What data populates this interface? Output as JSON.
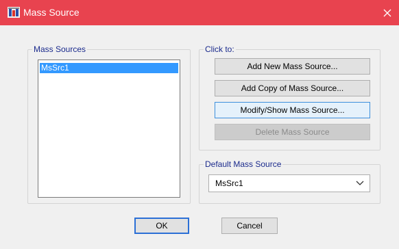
{
  "window": {
    "title": "Mass Source",
    "close_glyph": "✕"
  },
  "mass_sources_group": {
    "label": "Mass Sources",
    "items": [
      "MsSrc1"
    ]
  },
  "click_to_group": {
    "label": "Click to:",
    "buttons": {
      "add_new": "Add New Mass Source...",
      "add_copy": "Add Copy of Mass Source...",
      "modify_show": "Modify/Show Mass Source...",
      "delete": "Delete Mass Source"
    }
  },
  "default_group": {
    "label": "Default Mass Source",
    "selected": "MsSrc1"
  },
  "footer": {
    "ok": "OK",
    "cancel": "Cancel"
  },
  "colors": {
    "titlebar": "#e8434f",
    "selection": "#3399ff",
    "group_label": "#1a2a8c"
  },
  "icons": {
    "app": "app-icon",
    "close": "close-icon",
    "dropdown": "chevron-down-icon"
  }
}
